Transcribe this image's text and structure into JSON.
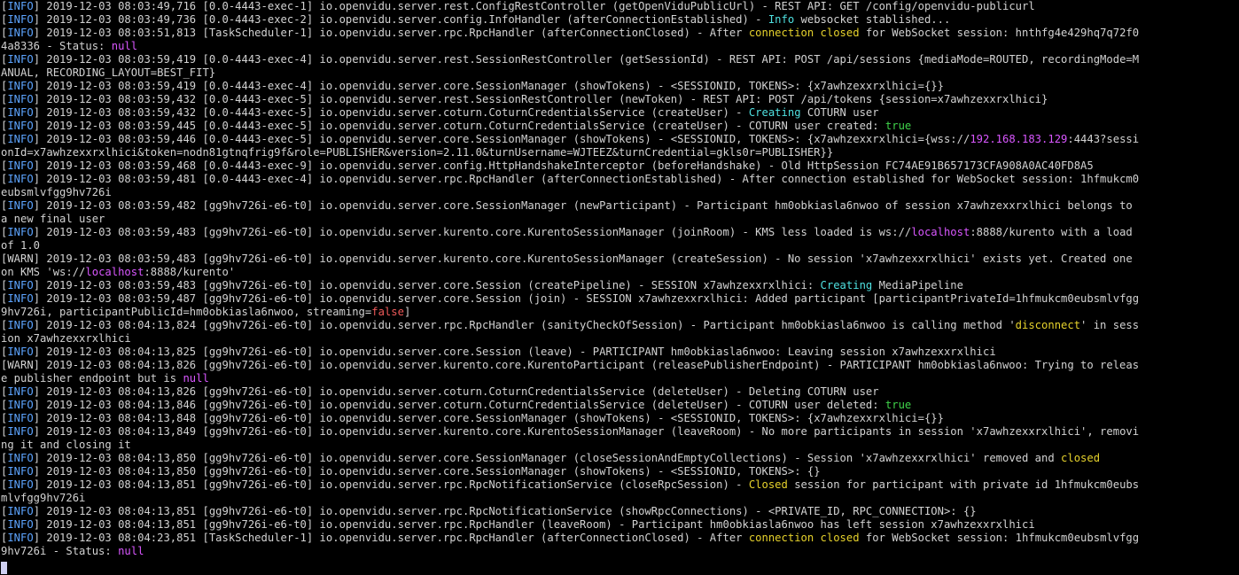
{
  "terminal": {
    "colors": {
      "text": "#d2d2d2",
      "blue": "#5da4ff",
      "yellow": "#e6d22c",
      "green": "#3fd34a",
      "magenta": "#d957ff",
      "cyan": "#4fe0e0",
      "red": "#ef5a5a",
      "background": "#000000",
      "cursor": "#cfd0f2"
    },
    "lines": [
      [
        [
          "text",
          "["
        ],
        [
          "blue",
          "INFO"
        ],
        [
          "text",
          "] 2019-12-03 08:03:49,716 [0.0-4443-exec-1] io.openvidu.server.rest.ConfigRestController (getOpenViduPublicUrl) - REST API: GET /config/openvidu-publicurl"
        ]
      ],
      [
        [
          "text",
          "["
        ],
        [
          "blue",
          "INFO"
        ],
        [
          "text",
          "] 2019-12-03 08:03:49,736 [0.0-4443-exec-2] io.openvidu.server.config.InfoHandler (afterConnectionEstablished) - "
        ],
        [
          "cyan",
          "Info"
        ],
        [
          "text",
          " websocket stablished..."
        ]
      ],
      [
        [
          "text",
          "["
        ],
        [
          "blue",
          "INFO"
        ],
        [
          "text",
          "] 2019-12-03 08:03:51,813 [TaskScheduler-1] io.openvidu.server.rpc.RpcHandler (afterConnectionClosed) - After "
        ],
        [
          "yellow",
          "connection"
        ],
        [
          "text",
          " "
        ],
        [
          "yellow",
          "closed"
        ],
        [
          "text",
          " for WebSocket session: hnthfg4e429hq7q72f0"
        ]
      ],
      [
        [
          "text",
          "4a8336 - Status: "
        ],
        [
          "magenta",
          "null"
        ]
      ],
      [
        [
          "text",
          "["
        ],
        [
          "blue",
          "INFO"
        ],
        [
          "text",
          "] 2019-12-03 08:03:59,419 [0.0-4443-exec-4] io.openvidu.server.rest.SessionRestController (getSessionId) - REST API: POST /api/sessions {mediaMode=ROUTED, recordingMode=M"
        ]
      ],
      [
        [
          "text",
          "ANUAL, RECORDING_LAYOUT=BEST_FIT}"
        ]
      ],
      [
        [
          "text",
          "["
        ],
        [
          "blue",
          "INFO"
        ],
        [
          "text",
          "] 2019-12-03 08:03:59,419 [0.0-4443-exec-4] io.openvidu.server.core.SessionManager (showTokens) - <SESSIONID, TOKENS>: {x7awhzexxrxlhici={}}"
        ]
      ],
      [
        [
          "text",
          "["
        ],
        [
          "blue",
          "INFO"
        ],
        [
          "text",
          "] 2019-12-03 08:03:59,432 [0.0-4443-exec-5] io.openvidu.server.rest.SessionRestController (newToken) - REST API: POST /api/tokens {session=x7awhzexxrxlhici}"
        ]
      ],
      [
        [
          "text",
          "["
        ],
        [
          "blue",
          "INFO"
        ],
        [
          "text",
          "] 2019-12-03 08:03:59,432 [0.0-4443-exec-5] io.openvidu.server.coturn.CoturnCredentialsService (createUser) - "
        ],
        [
          "cyan",
          "Creating"
        ],
        [
          "text",
          " COTURN user"
        ]
      ],
      [
        [
          "text",
          "["
        ],
        [
          "blue",
          "INFO"
        ],
        [
          "text",
          "] 2019-12-03 08:03:59,445 [0.0-4443-exec-5] io.openvidu.server.coturn.CoturnCredentialsService (createUser) - COTURN user created: "
        ],
        [
          "green",
          "true"
        ]
      ],
      [
        [
          "text",
          "["
        ],
        [
          "blue",
          "INFO"
        ],
        [
          "text",
          "] 2019-12-03 08:03:59,446 [0.0-4443-exec-5] io.openvidu.server.core.SessionManager (showTokens) - <SESSIONID, TOKENS>: {x7awhzexxrxlhici={wss://"
        ],
        [
          "magenta",
          "192.168.183.129"
        ],
        [
          "text",
          ":4443?sessi"
        ]
      ],
      [
        [
          "text",
          "onId=x7awhzexxrxlhici&token=nodn81gtnqfrig9f&role=PUBLISHER&version=2.11.0&turnUsername=WJTEEZ&turnCredential=gkls0r=PUBLISHER}}"
        ]
      ],
      [
        [
          "text",
          "["
        ],
        [
          "blue",
          "INFO"
        ],
        [
          "text",
          "] 2019-12-03 08:03:59,468 [0.0-4443-exec-9] io.openvidu.server.config.HttpHandshakeInterceptor (beforeHandshake) - Old HttpSession FC74AE91B657173CFA908A0AC40FD8A5"
        ]
      ],
      [
        [
          "text",
          "["
        ],
        [
          "blue",
          "INFO"
        ],
        [
          "text",
          "] 2019-12-03 08:03:59,481 [0.0-4443-exec-4] io.openvidu.server.rpc.RpcHandler (afterConnectionEstablished) - After connection established for WebSocket session: 1hfmukcm0"
        ]
      ],
      [
        [
          "text",
          "eubsmlvfgg9hv726i"
        ]
      ],
      [
        [
          "text",
          "["
        ],
        [
          "blue",
          "INFO"
        ],
        [
          "text",
          "] 2019-12-03 08:03:59,482 [gg9hv726i-e6-t0] io.openvidu.server.core.SessionManager (newParticipant) - Participant hm0obkiasla6nwoo of session x7awhzexxrxlhici belongs to"
        ]
      ],
      [
        [
          "text",
          "a new final user"
        ]
      ],
      [
        [
          "text",
          "["
        ],
        [
          "blue",
          "INFO"
        ],
        [
          "text",
          "] 2019-12-03 08:03:59,483 [gg9hv726i-e6-t0] io.openvidu.server.kurento.core.KurentoSessionManager (joinRoom) - KMS less loaded is ws://"
        ],
        [
          "magenta",
          "localhost"
        ],
        [
          "text",
          ":8888/kurento with a load"
        ]
      ],
      [
        [
          "text",
          "of 1.0"
        ]
      ],
      [
        [
          "text",
          "[WARN] 2019-12-03 08:03:59,483 [gg9hv726i-e6-t0] io.openvidu.server.kurento.core.KurentoSessionManager (createSession) - No session 'x7awhzexxrxlhici' exists yet. Created one"
        ]
      ],
      [
        [
          "text",
          "on KMS 'ws://"
        ],
        [
          "magenta",
          "localhost"
        ],
        [
          "text",
          ":8888/kurento'"
        ]
      ],
      [
        [
          "text",
          "["
        ],
        [
          "blue",
          "INFO"
        ],
        [
          "text",
          "] 2019-12-03 08:03:59,483 [gg9hv726i-e6-t0] io.openvidu.server.core.Session (createPipeline) - SESSION x7awhzexxrxlhici: "
        ],
        [
          "cyan",
          "Creating"
        ],
        [
          "text",
          " MediaPipeline"
        ]
      ],
      [
        [
          "text",
          "["
        ],
        [
          "blue",
          "INFO"
        ],
        [
          "text",
          "] 2019-12-03 08:03:59,487 [gg9hv726i-e6-t0] io.openvidu.server.core.Session (join) - SESSION x7awhzexxrxlhici: Added participant [participantPrivateId=1hfmukcm0eubsmlvfgg"
        ]
      ],
      [
        [
          "text",
          "9hv726i, participantPublicId=hm0obkiasla6nwoo, streaming="
        ],
        [
          "red",
          "false"
        ],
        [
          "text",
          "]"
        ]
      ],
      [
        [
          "text",
          "["
        ],
        [
          "blue",
          "INFO"
        ],
        [
          "text",
          "] 2019-12-03 08:04:13,824 [gg9hv726i-e6-t0] io.openvidu.server.rpc.RpcHandler (sanityCheckOfSession) - Participant hm0obkiasla6nwoo is calling method '"
        ],
        [
          "yellow",
          "disconnect"
        ],
        [
          "text",
          "' in sess"
        ]
      ],
      [
        [
          "text",
          "ion x7awhzexxrxlhici"
        ]
      ],
      [
        [
          "text",
          "["
        ],
        [
          "blue",
          "INFO"
        ],
        [
          "text",
          "] 2019-12-03 08:04:13,825 [gg9hv726i-e6-t0] io.openvidu.server.core.Session (leave) - PARTICIPANT hm0obkiasla6nwoo: Leaving session x7awhzexxrxlhici"
        ]
      ],
      [
        [
          "text",
          "[WARN] 2019-12-03 08:04:13,826 [gg9hv726i-e6-t0] io.openvidu.server.kurento.core.KurentoParticipant (releasePublisherEndpoint) - PARTICIPANT hm0obkiasla6nwoo: Trying to releas"
        ]
      ],
      [
        [
          "text",
          "e publisher endpoint but is "
        ],
        [
          "magenta",
          "null"
        ]
      ],
      [
        [
          "text",
          "["
        ],
        [
          "blue",
          "INFO"
        ],
        [
          "text",
          "] 2019-12-03 08:04:13,826 [gg9hv726i-e6-t0] io.openvidu.server.coturn.CoturnCredentialsService (deleteUser) - Deleting COTURN user"
        ]
      ],
      [
        [
          "text",
          "["
        ],
        [
          "blue",
          "INFO"
        ],
        [
          "text",
          "] 2019-12-03 08:04:13,846 [gg9hv726i-e6-t0] io.openvidu.server.coturn.CoturnCredentialsService (deleteUser) - COTURN user deleted: "
        ],
        [
          "green",
          "true"
        ]
      ],
      [
        [
          "text",
          "["
        ],
        [
          "blue",
          "INFO"
        ],
        [
          "text",
          "] 2019-12-03 08:04:13,848 [gg9hv726i-e6-t0] io.openvidu.server.core.SessionManager (showTokens) - <SESSIONID, TOKENS>: {x7awhzexxrxlhici={}}"
        ]
      ],
      [
        [
          "text",
          "["
        ],
        [
          "blue",
          "INFO"
        ],
        [
          "text",
          "] 2019-12-03 08:04:13,849 [gg9hv726i-e6-t0] io.openvidu.server.kurento.core.KurentoSessionManager (leaveRoom) - No more participants in session 'x7awhzexxrxlhici', removi"
        ]
      ],
      [
        [
          "text",
          "ng it and closing it"
        ]
      ],
      [
        [
          "text",
          "["
        ],
        [
          "blue",
          "INFO"
        ],
        [
          "text",
          "] 2019-12-03 08:04:13,850 [gg9hv726i-e6-t0] io.openvidu.server.core.SessionManager (closeSessionAndEmptyCollections) - Session 'x7awhzexxrxlhici' removed and "
        ],
        [
          "yellow",
          "closed"
        ]
      ],
      [
        [
          "text",
          "["
        ],
        [
          "blue",
          "INFO"
        ],
        [
          "text",
          "] 2019-12-03 08:04:13,850 [gg9hv726i-e6-t0] io.openvidu.server.core.SessionManager (showTokens) - <SESSIONID, TOKENS>: {}"
        ]
      ],
      [
        [
          "text",
          "["
        ],
        [
          "blue",
          "INFO"
        ],
        [
          "text",
          "] 2019-12-03 08:04:13,851 [gg9hv726i-e6-t0] io.openvidu.server.rpc.RpcNotificationService (closeRpcSession) - "
        ],
        [
          "yellow",
          "Closed"
        ],
        [
          "text",
          " session for participant with private id 1hfmukcm0eubs"
        ]
      ],
      [
        [
          "text",
          "mlvfgg9hv726i"
        ]
      ],
      [
        [
          "text",
          "["
        ],
        [
          "blue",
          "INFO"
        ],
        [
          "text",
          "] 2019-12-03 08:04:13,851 [gg9hv726i-e6-t0] io.openvidu.server.rpc.RpcNotificationService (showRpcConnections) - <PRIVATE_ID, RPC_CONNECTION>: {}"
        ]
      ],
      [
        [
          "text",
          "["
        ],
        [
          "blue",
          "INFO"
        ],
        [
          "text",
          "] 2019-12-03 08:04:13,851 [gg9hv726i-e6-t0] io.openvidu.server.rpc.RpcHandler (leaveRoom) - Participant hm0obkiasla6nwoo has left session x7awhzexxrxlhici"
        ]
      ],
      [
        [
          "text",
          "["
        ],
        [
          "blue",
          "INFO"
        ],
        [
          "text",
          "] 2019-12-03 08:04:23,851 [TaskScheduler-1] io.openvidu.server.rpc.RpcHandler (afterConnectionClosed) - After "
        ],
        [
          "yellow",
          "connection"
        ],
        [
          "text",
          " "
        ],
        [
          "yellow",
          "closed"
        ],
        [
          "text",
          " for WebSocket session: 1hfmukcm0eubsmlvfgg"
        ]
      ],
      [
        [
          "text",
          "9hv726i - Status: "
        ],
        [
          "magenta",
          "null"
        ]
      ]
    ]
  }
}
